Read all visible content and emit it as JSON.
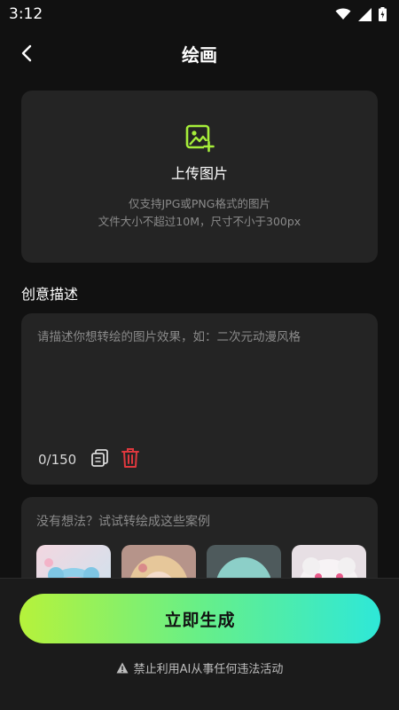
{
  "status_bar": {
    "time": "3:12",
    "icons": [
      "wifi-icon",
      "cellular-icon",
      "battery-charging-icon"
    ]
  },
  "header": {
    "back_icon": "chevron-left-icon",
    "title": "绘画"
  },
  "upload": {
    "icon": "image-add-icon",
    "title": "上传图片",
    "hint_line1": "仅支持JPG或PNG格式的图片",
    "hint_line2": "文件大小不超过10M，尺寸不小于300px"
  },
  "prompt": {
    "section_title": "创意描述",
    "placeholder": "请描述你想转绘的图片效果，如：二次元动漫风格",
    "value": "",
    "char_count": "0/150",
    "copy_icon": "copy-icon",
    "delete_icon": "trash-icon"
  },
  "examples": {
    "title": "没有想法？试试转绘成这些案例",
    "items": [
      "bear-hat-girl-thumbnail",
      "blonde-doll-thumbnail",
      "teal-hair-figure-thumbnail",
      "pink-bunny-girl-thumbnail"
    ]
  },
  "footer": {
    "generate_label": "立即生成",
    "notice": "禁止利用AI从事任何违法活动",
    "notice_icon": "warning-icon"
  },
  "colors": {
    "background": "#111111",
    "card": "#242424",
    "accent_start": "#b6f23b",
    "accent_end": "#2ee8d8",
    "delete_red": "#e0383e"
  }
}
